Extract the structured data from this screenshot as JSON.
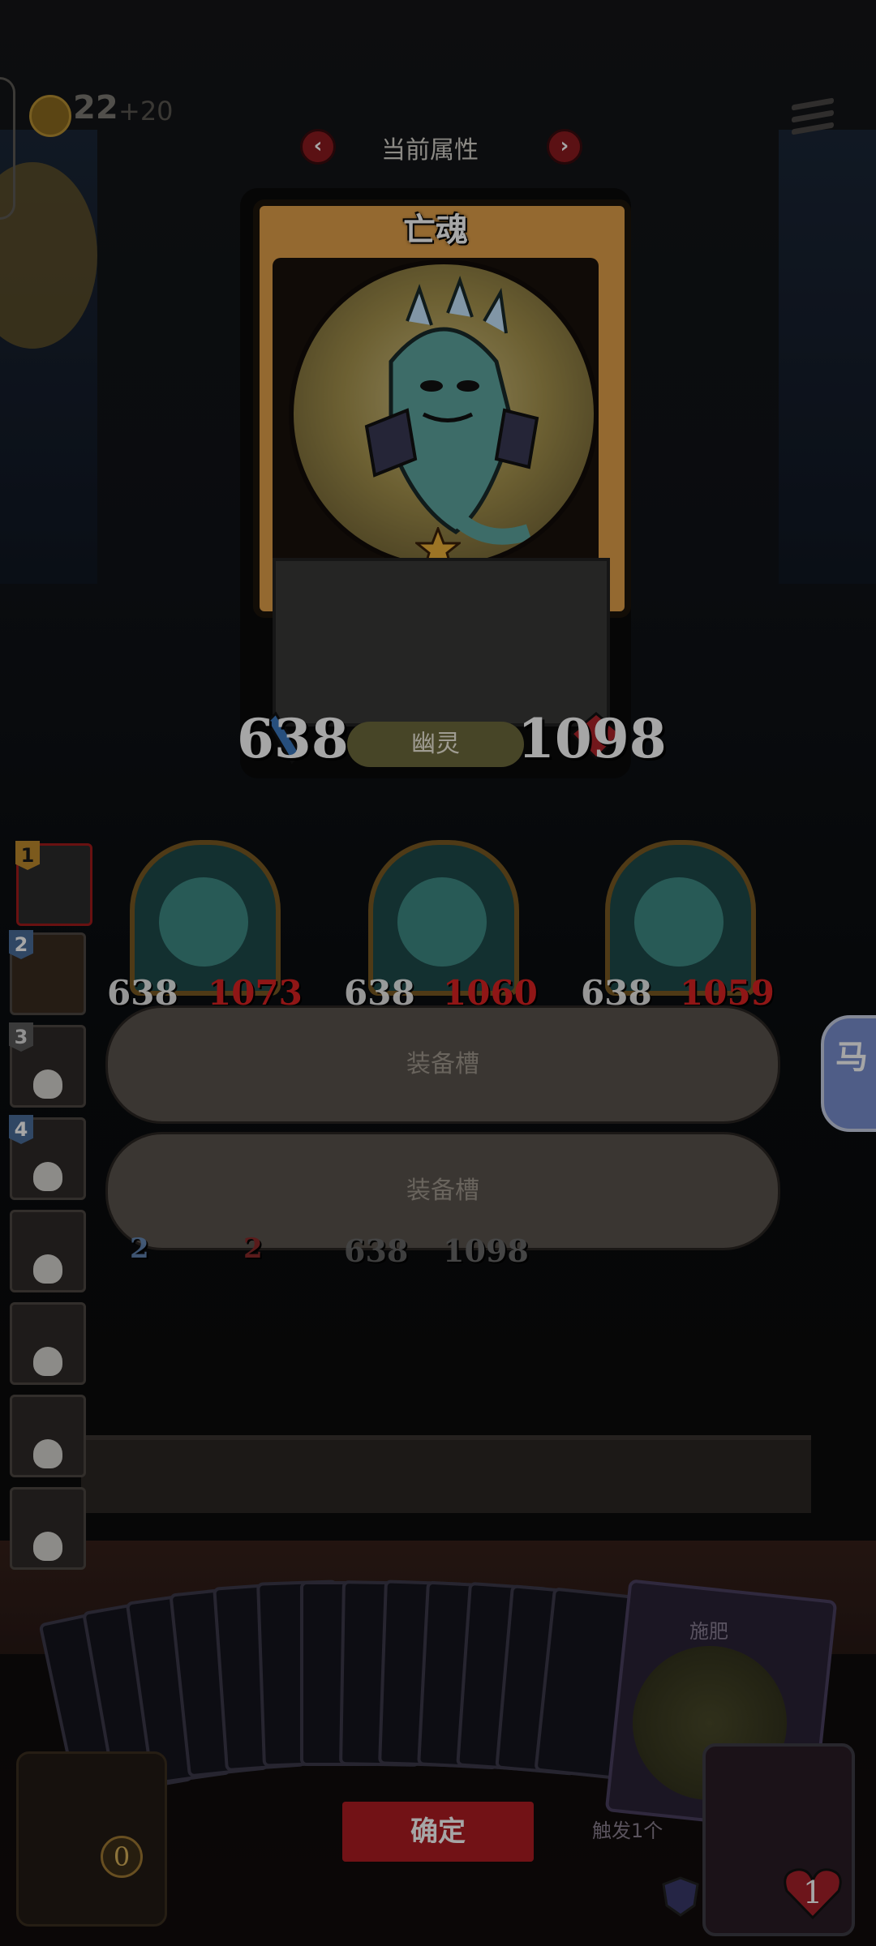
{
  "top_bar": {
    "coins": "22",
    "coins_bonus": "+20"
  },
  "panel": {
    "title": "当前属性",
    "prev_icon": "chevron-left-icon",
    "next_icon": "chevron-right-icon"
  },
  "card": {
    "name": "亡魂",
    "attack": "638",
    "health": "1098",
    "type": "幽灵",
    "stars": 1
  },
  "heroes": [
    {
      "num": "1",
      "selected": true
    },
    {
      "num": "2",
      "selected": false
    },
    {
      "num": "3",
      "selected": false
    },
    {
      "num": "4",
      "selected": false
    },
    {
      "num": "",
      "selected": false
    },
    {
      "num": "",
      "selected": false
    },
    {
      "num": "",
      "selected": false
    },
    {
      "num": "",
      "selected": false
    }
  ],
  "board": {
    "minions": [
      {
        "attack": "638",
        "health": "1073"
      },
      {
        "attack": "638",
        "health": "1060"
      },
      {
        "attack": "638",
        "health": "1059"
      }
    ],
    "row2": [
      {
        "attack": "2",
        "health": "2"
      },
      {
        "attack": "638",
        "health": "1098"
      }
    ]
  },
  "equipment": {
    "slot1_label": "装备槽",
    "slot2_label": "装备槽"
  },
  "deck": {
    "feature_card_title": "施肥",
    "trigger_text": "触发1个",
    "confirm_label": "确定",
    "counter": "0"
  },
  "player": {
    "life": "1"
  },
  "side_tab": {
    "label": "马"
  }
}
